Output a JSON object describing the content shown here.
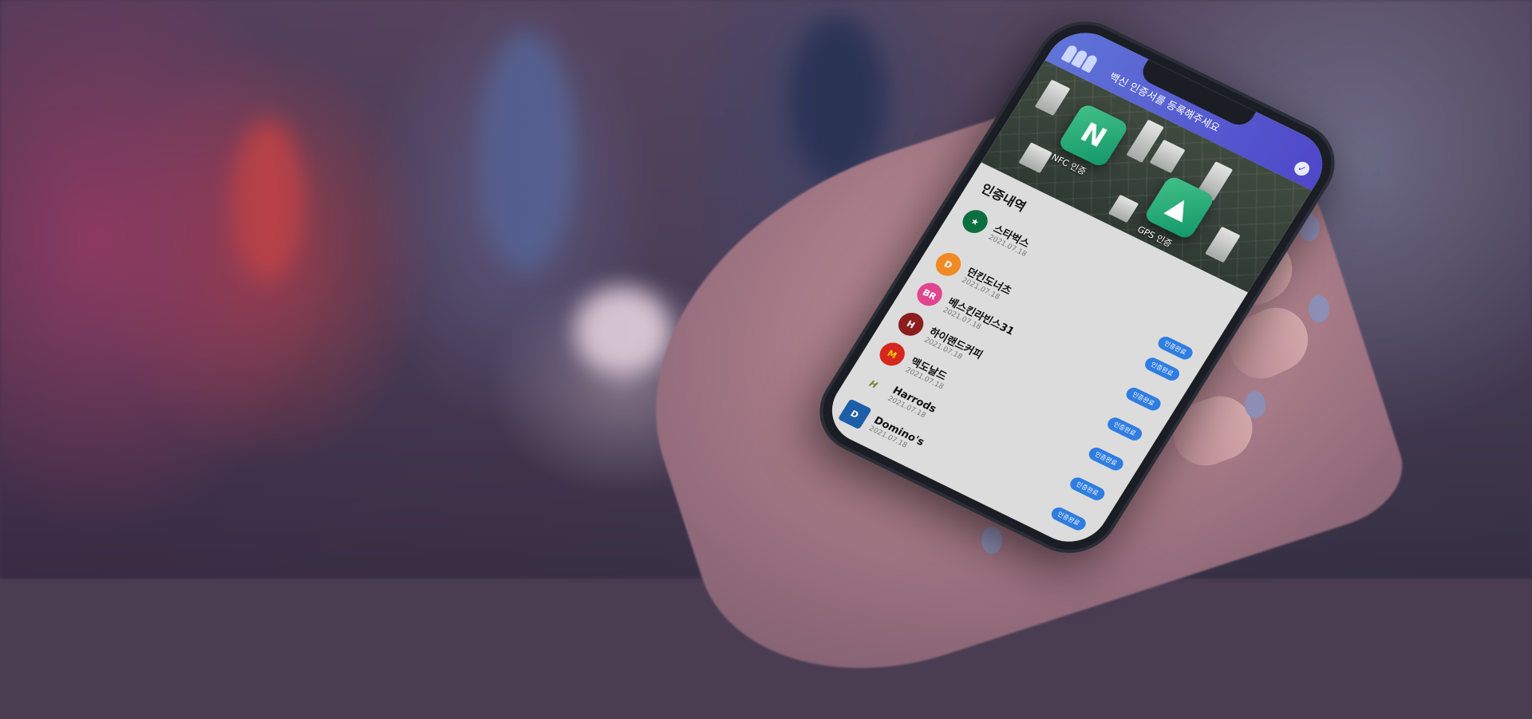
{
  "app": {
    "banner_text": "백신 인증서를 등록해주세요",
    "auth_methods": [
      {
        "label": "NFC 인증",
        "icon": "nfc-icon",
        "glyph": "N"
      },
      {
        "label": "GPS 인증",
        "icon": "gps-navigation-icon",
        "glyph": "▲"
      }
    ],
    "history_title": "인증내역",
    "badge_label": "인증완료",
    "items": [
      {
        "name": "스타벅스",
        "date": "2021.07.18",
        "logo": "starbucks-logo",
        "color": "#0b6e3f",
        "mark": "★"
      },
      {
        "name": "던킨도너츠",
        "date": "2021.07.18",
        "logo": "dunkin-logo",
        "color": "#f08a24",
        "mark": "D"
      },
      {
        "name": "베스킨라빈스31",
        "date": "2021.07.18",
        "logo": "baskin-robbins-logo",
        "color": "#e0458f",
        "mark": "BR"
      },
      {
        "name": "하이랜드커피",
        "date": "2021.07.18",
        "logo": "highlands-coffee-logo",
        "color": "#8b1d1d",
        "mark": "H"
      },
      {
        "name": "맥도날드",
        "date": "2021.07.18",
        "logo": "mcdonalds-logo",
        "color": "#d7261e",
        "mark": "M"
      },
      {
        "name": "Harrods",
        "date": "2021.07.18",
        "logo": "harrods-logo",
        "color": "#7a7d2c",
        "mark": "H"
      },
      {
        "name": "Domino's",
        "date": "2021.07.18",
        "logo": "dominos-logo",
        "color": "#1c5ea8",
        "mark": "D"
      }
    ]
  }
}
